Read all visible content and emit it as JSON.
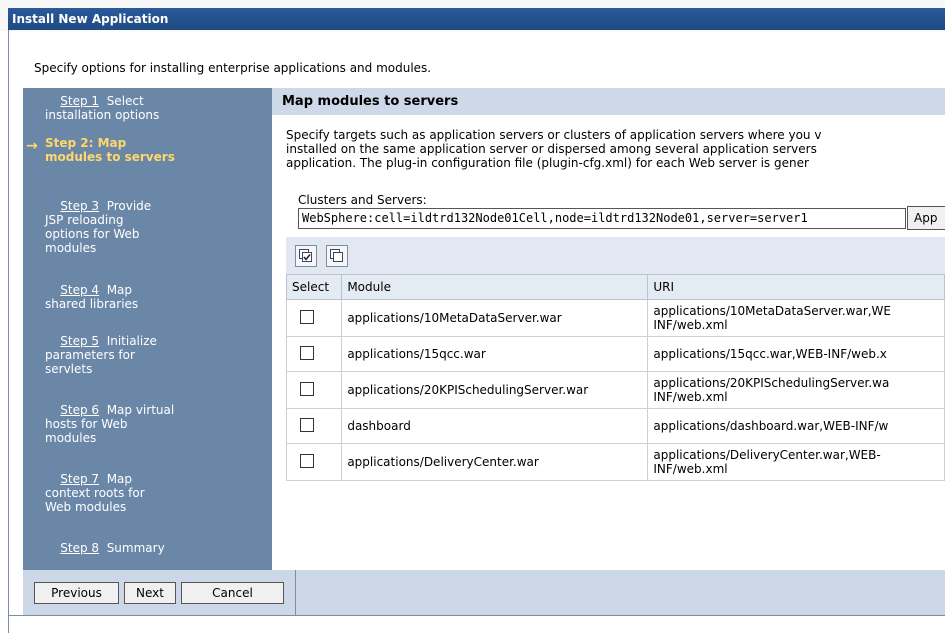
{
  "window": {
    "title": "Install New Application"
  },
  "intro": "Specify options for installing enterprise applications and modules.",
  "steps": {
    "s1": {
      "link": "Step 1",
      "rest": [
        "Select",
        "installation options"
      ]
    },
    "s2": {
      "lines": [
        "Step 2: Map",
        "modules to servers"
      ]
    },
    "s3": {
      "link": "Step 3",
      "rest": [
        "Provide",
        "JSP reloading",
        "options for Web",
        "modules"
      ]
    },
    "s4": {
      "link": "Step 4",
      "rest": [
        "Map",
        "shared libraries"
      ]
    },
    "s5": {
      "link": "Step 5",
      "rest": [
        "Initialize",
        "parameters for",
        "servlets"
      ]
    },
    "s6": {
      "link": "Step 6",
      "rest": [
        "Map virtual",
        "hosts for Web",
        "modules"
      ]
    },
    "s7": {
      "link": "Step 7",
      "rest": [
        "Map",
        "context roots for",
        "Web modules"
      ]
    },
    "s8": {
      "link": "Step 8",
      "rest": [
        "Summary"
      ]
    }
  },
  "content": {
    "title": "Map modules to servers",
    "desc": [
      "Specify targets such as application servers or clusters of application servers where you v",
      "installed on the same application server or dispersed among several application servers",
      "application. The plug-in configuration file (plugin-cfg.xml) for each Web server is gener"
    ],
    "clusters_label": "Clusters and Servers:",
    "clusters_value": "WebSphere:cell=ildtrd132Node01Cell,node=ildtrd132Node01,server=server1",
    "apply_label": "App"
  },
  "table": {
    "headers": {
      "select": "Select",
      "module": "Module",
      "uri": "URI"
    },
    "rows": [
      {
        "module": "applications/10MetaDataServer.war",
        "uri1": "applications/10MetaDataServer.war,WE",
        "uri2": "INF/web.xml"
      },
      {
        "module": "applications/15qcc.war",
        "uri1": "applications/15qcc.war,WEB-INF/web.x",
        "uri2": ""
      },
      {
        "module": "applications/20KPISchedulingServer.war",
        "uri1": "applications/20KPISchedulingServer.wa",
        "uri2": "INF/web.xml"
      },
      {
        "module": "dashboard",
        "uri1": "applications/dashboard.war,WEB-INF/w",
        "uri2": ""
      },
      {
        "module": "applications/DeliveryCenter.war",
        "uri1": "applications/DeliveryCenter.war,WEB-",
        "uri2": "INF/web.xml"
      }
    ]
  },
  "footer": {
    "previous": "Previous",
    "next": "Next",
    "cancel": "Cancel"
  },
  "icons": {
    "select_all": "select-all-icon",
    "deselect_all": "deselect-all-icon"
  }
}
